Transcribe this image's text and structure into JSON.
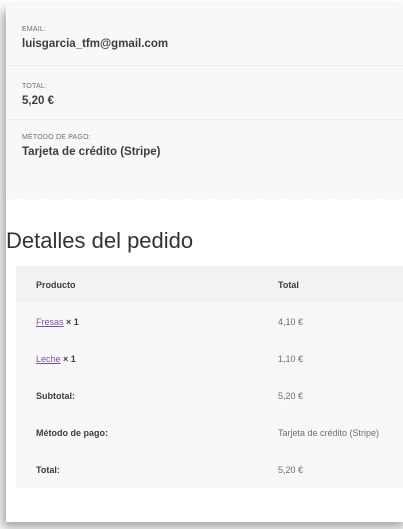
{
  "summary": {
    "email_label": "EMAIL:",
    "email_value": "luisgarcia_tfm@gmail.com",
    "total_label": "TOTAL:",
    "total_value": "5,20 €",
    "payment_label": "MÉTODO DE PAGO:",
    "payment_value": "Tarjeta de crédito (Stripe)"
  },
  "details": {
    "title": "Detalles del pedido",
    "headers": {
      "product": "Producto",
      "total": "Total"
    },
    "items": [
      {
        "name": "Fresas",
        "qty": "× 1",
        "total": "4,10 €"
      },
      {
        "name": "Leche",
        "qty": "× 1",
        "total": "1,10 €"
      }
    ],
    "subtotal_label": "Subtotal:",
    "subtotal_value": "5,20 €",
    "payment_label": "Método de pago:",
    "payment_value": "Tarjeta de crédito (Stripe)",
    "total_label": "Total:",
    "total_value": "5,20 €"
  },
  "colors": {
    "link": "#7b52ab",
    "panel": "#f8f8f8"
  }
}
